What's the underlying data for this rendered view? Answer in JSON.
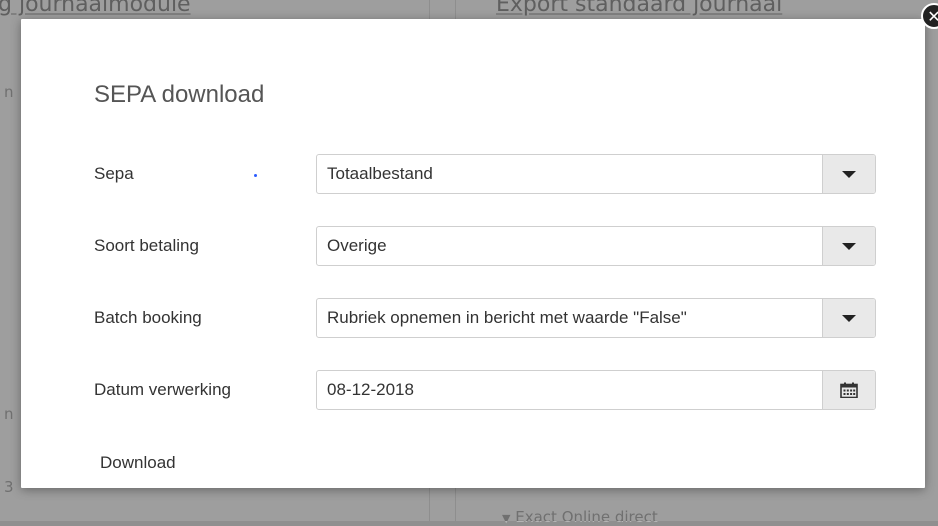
{
  "background": {
    "left_heading": "g journaalmodule",
    "right_heading": "Export standaard journaal",
    "bottom_link": "Exact Online direct",
    "edge_chars": [
      "n",
      "n",
      "3"
    ]
  },
  "modal": {
    "title": "SEPA download",
    "close_icon": "close-icon",
    "rows": [
      {
        "label": "Sepa",
        "value": "Totaalbestand",
        "control": "select"
      },
      {
        "label": "Soort betaling",
        "value": "Overige",
        "control": "select"
      },
      {
        "label": "Batch booking",
        "value": "Rubriek opnemen in bericht met waarde \"False\"",
        "control": "select"
      },
      {
        "label": "Datum verwerking",
        "value": "08-12-2018",
        "control": "date"
      }
    ],
    "download_label": "Download"
  },
  "colors": {
    "overlay": "rgba(0,0,0,0.38)",
    "button_bg": "#e9e9e9",
    "indicator_dot": "#2a5cff"
  }
}
